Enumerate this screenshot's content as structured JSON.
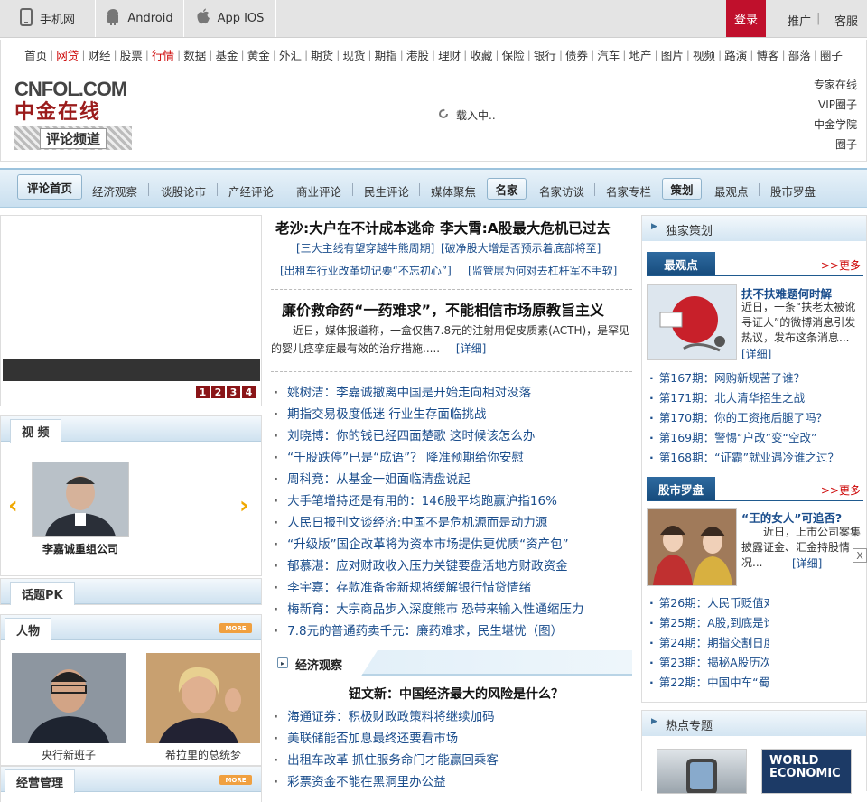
{
  "topbar": {
    "mobile": "手机网",
    "android": "Android",
    "ios": "App IOS",
    "login": "登录",
    "promote": "推广",
    "service": "客服"
  },
  "nav": [
    "首页",
    "网贷",
    "财经",
    "股票",
    "行情",
    "数据",
    "基金",
    "黄金",
    "外汇",
    "期货",
    "现货",
    "期指",
    "港股",
    "理财",
    "收藏",
    "保险",
    "银行",
    "债券",
    "汽车",
    "地产",
    "图片",
    "视频",
    "路演",
    "博客",
    "部落",
    "圈子"
  ],
  "nav_red": [
    "网贷",
    "行情"
  ],
  "header": {
    "logo_top": "CNFOL.COM",
    "logo_cn": "中金在线",
    "logo_sub": "评论频道",
    "loading": "载入中..",
    "links": [
      "专家在线",
      "VIP圈子",
      "中金学院",
      "圈子"
    ]
  },
  "channel": {
    "home": "评论首页",
    "items": [
      "经济观察",
      "谈股论市",
      "产经评论",
      "商业评论",
      "民生评论",
      "媒体聚焦"
    ],
    "tab_mingjia": "名家",
    "mingjia_items": [
      "名家访谈",
      "名家专栏"
    ],
    "tab_cehua": "策划",
    "cehua_items": [
      "最观点",
      "股市罗盘"
    ]
  },
  "slider": {
    "pages": [
      "1",
      "2",
      "3",
      "4"
    ]
  },
  "left": {
    "video_title": "视 频",
    "video_caption": "李嘉诚重组公司",
    "pk_title": "话题PK",
    "people_title": "人物",
    "more": "MORE",
    "people": [
      {
        "caption": "央行新班子"
      },
      {
        "caption": "希拉里的总统梦"
      }
    ],
    "mgmt_title": "经营管理"
  },
  "center": {
    "headline1": "老沙:大户在不计成本逃命 李大霄:A股最大危机已过去",
    "sub1": [
      "[三大主线有望穿越牛熊周期]",
      "[破净股大增是否预示着底部将至]"
    ],
    "sub2": [
      "[出租车行业改革切记要“不忘初心”]",
      "[监管层为何对去杠杆军不手软]"
    ],
    "headline2": "廉价救命药“一药难求”，不能相信市场原教旨主义",
    "summary": "近日，媒体报道称，一盒仅售7.8元的注射用促皮质素(ACTH)，是罕见的婴儿痉挛症最有效的治疗措施.....",
    "detail": "[详细]",
    "news": [
      "姚树洁：李嘉诚撤离中国是开始走向相对没落",
      "期指交易极度低迷 行业生存面临挑战",
      "刘晓博：你的钱已经四面楚歌 这时候该怎么办",
      "“千股跌停”已是“成语”？ 降准预期给你安慰",
      "周科竞：从基金一姐面临清盘说起",
      "大手笔增持还是有用的：146股平均跑赢沪指16%",
      "人民日报刊文谈经济:中国不是危机源而是动力源",
      "“升级版”国企改革将为资本市场提供更优质“资产包”",
      "郁慕湛：应对财政收入压力关键要盘活地方财政资金",
      "李宇嘉：存款准备金新规将缓解银行惜贷情绪",
      "梅新育：大宗商品步入深度熊市 恐带来输入性通缩压力",
      "7.8元的普通药卖千元：廉药难求，民生堪忧（图）"
    ],
    "eco_title": "经济观察",
    "eco_headline": "钮文新：中国经济最大的风险是什么？",
    "eco_news": [
      "海通证券：积极财政政策料将继续加码",
      "美联储能否加息最终还要看市场",
      "出租车改革 抓住服务命门才能赢回乘客",
      "彩票资金不能在黑洞里办公益"
    ]
  },
  "right": {
    "title": "独家策划",
    "zgd_tab": "最观点",
    "more": ">>更多",
    "zgd_headline": "扶不扶难题何时解",
    "zgd_summary": "近日，一条“扶老太被讹寻证人”的微博消息引发热议，发布这条消息...",
    "detail": "[详细]",
    "zgd_list": [
      "第167期：网购新规苦了谁？",
      "第171期：北大清华招生之战",
      "第170期：你的工资拖后腿了吗？",
      "第169期：警惕“户改”变“空改”",
      "第168期：“证霸”就业遇冷谁之过？"
    ],
    "gslp_tab": "股市罗盘",
    "gslp_headline": "“王的女人”可追否?",
    "gslp_summary": "近日，上市公司案集披露证金、汇金持股情况...",
    "gslp_detail": "[详细]",
    "gslp_list": [
      "第26期：人民币贬值对",
      "第25期：A股,到底是谁",
      "第24期：期指交割日度",
      "第23期：揭秘A股历次",
      "第22期：中国中车“蜀"
    ],
    "close": "X",
    "hot_title": "热点专题",
    "hot_img2": "WORLD ECONOMIC"
  },
  "colors": {
    "red": "#c0102c",
    "blue_link": "#1a4d8c",
    "tab_blue": "#1f5a8f"
  }
}
